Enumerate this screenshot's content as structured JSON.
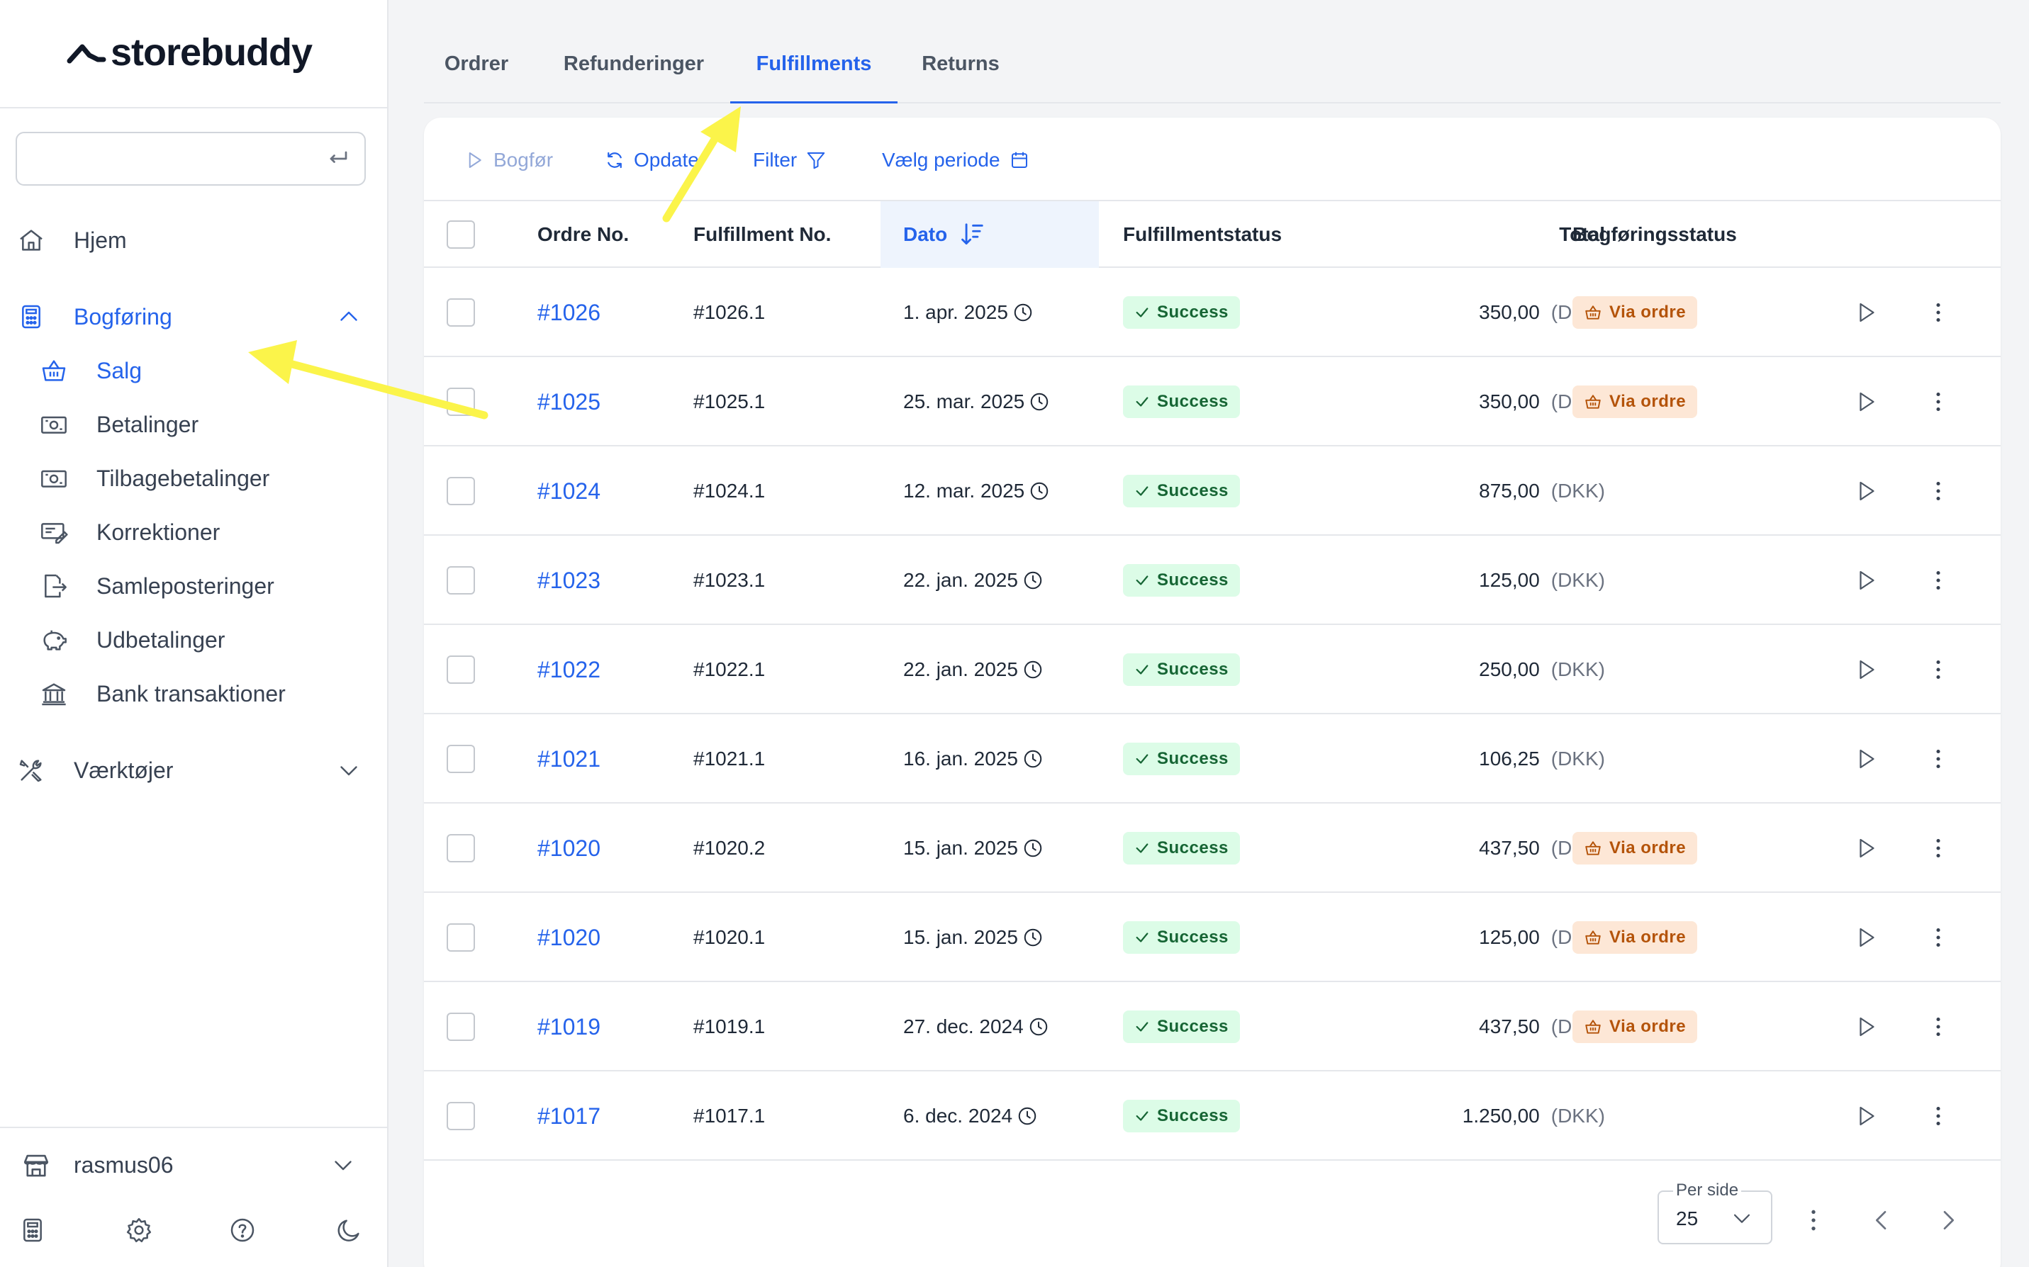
{
  "brand": {
    "name": "storebuddy"
  },
  "sidebar": {
    "search_placeholder": "",
    "items": [
      {
        "label": "Hjem",
        "icon": "home-icon"
      },
      {
        "label": "Bogføring",
        "icon": "calculator-icon",
        "expanded": true
      },
      {
        "label": "Værktøjer",
        "icon": "tools-icon",
        "expanded": false
      }
    ],
    "subitems": [
      {
        "label": "Salg",
        "icon": "basket-icon",
        "active": true
      },
      {
        "label": "Betalinger",
        "icon": "banknote-icon"
      },
      {
        "label": "Tilbagebetalinger",
        "icon": "banknote-icon"
      },
      {
        "label": "Korrektioner",
        "icon": "edit-card-icon"
      },
      {
        "label": "Samleposteringer",
        "icon": "file-export-icon"
      },
      {
        "label": "Udbetalinger",
        "icon": "piggy-bank-icon"
      },
      {
        "label": "Bank transaktioner",
        "icon": "bank-icon"
      }
    ],
    "user": {
      "label": "rasmus06"
    }
  },
  "tabs": [
    {
      "label": "Ordrer"
    },
    {
      "label": "Refunderinger"
    },
    {
      "label": "Fulfillments",
      "active": true
    },
    {
      "label": "Returns"
    }
  ],
  "toolbar": {
    "bogfor": "Bogfør",
    "opdater": "Opdate",
    "filter": "Filter",
    "periode": "Vælg periode"
  },
  "table": {
    "headers": {
      "order": "Ordre No.",
      "fulfillment": "Fulfillment No.",
      "date": "Dato",
      "status": "Fulfillmentstatus",
      "total": "Total",
      "booking": "Bogføringsstatus"
    },
    "rows": [
      {
        "order": "#1026",
        "fulfillment": "#1026.1",
        "date": "1. apr. 2025",
        "status": "Success",
        "amount": "350,00",
        "currency": "(DKK)",
        "booking": "Via ordre"
      },
      {
        "order": "#1025",
        "fulfillment": "#1025.1",
        "date": "25. mar. 2025",
        "status": "Success",
        "amount": "350,00",
        "currency": "(DKK)",
        "booking": "Via ordre"
      },
      {
        "order": "#1024",
        "fulfillment": "#1024.1",
        "date": "12. mar. 2025",
        "status": "Success",
        "amount": "875,00",
        "currency": "(DKK)",
        "booking": ""
      },
      {
        "order": "#1023",
        "fulfillment": "#1023.1",
        "date": "22. jan. 2025",
        "status": "Success",
        "amount": "125,00",
        "currency": "(DKK)",
        "booking": ""
      },
      {
        "order": "#1022",
        "fulfillment": "#1022.1",
        "date": "22. jan. 2025",
        "status": "Success",
        "amount": "250,00",
        "currency": "(DKK)",
        "booking": ""
      },
      {
        "order": "#1021",
        "fulfillment": "#1021.1",
        "date": "16. jan. 2025",
        "status": "Success",
        "amount": "106,25",
        "currency": "(DKK)",
        "booking": ""
      },
      {
        "order": "#1020",
        "fulfillment": "#1020.2",
        "date": "15. jan. 2025",
        "status": "Success",
        "amount": "437,50",
        "currency": "(DKK)",
        "booking": "Via ordre"
      },
      {
        "order": "#1020",
        "fulfillment": "#1020.1",
        "date": "15. jan. 2025",
        "status": "Success",
        "amount": "125,00",
        "currency": "(DKK)",
        "booking": "Via ordre"
      },
      {
        "order": "#1019",
        "fulfillment": "#1019.1",
        "date": "27. dec. 2024",
        "status": "Success",
        "amount": "437,50",
        "currency": "(DKK)",
        "booking": "Via ordre"
      },
      {
        "order": "#1017",
        "fulfillment": "#1017.1",
        "date": "6. dec. 2024",
        "status": "Success",
        "amount": "1.250,00",
        "currency": "(DKK)",
        "booking": ""
      }
    ]
  },
  "pagination": {
    "per_side_label": "Per side",
    "per_side_value": "25"
  },
  "colors": {
    "accent": "#2563eb",
    "success_bg": "#dcfce7",
    "success_fg": "#166534",
    "via_bg": "#fde7d6",
    "via_fg": "#b45309",
    "annotation": "#fbf44a"
  }
}
